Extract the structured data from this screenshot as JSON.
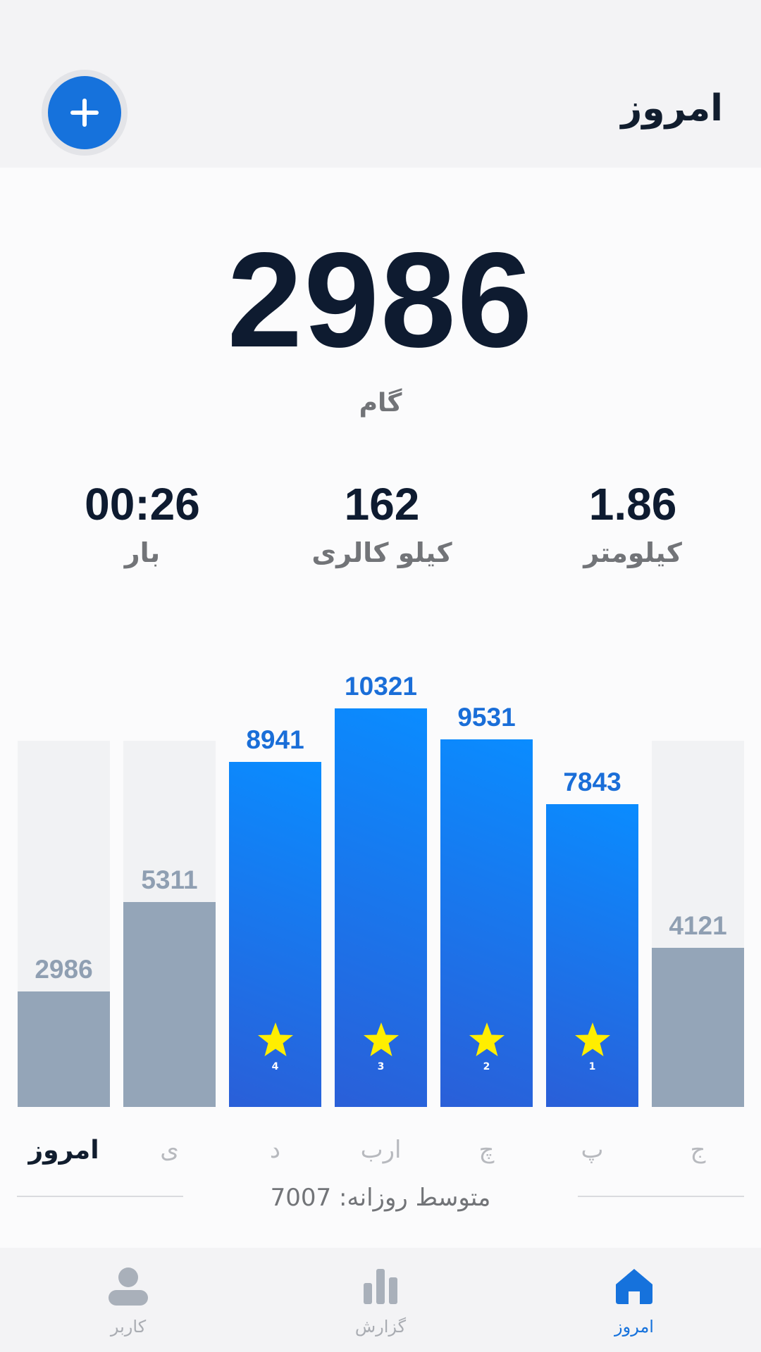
{
  "header": {
    "title": "امروز"
  },
  "summary": {
    "steps": "2986",
    "steps_unit": "گام",
    "stats": [
      {
        "value": "1.86",
        "label": "کیلومتر"
      },
      {
        "value": "162",
        "label": "کیلو کالری"
      },
      {
        "value": "00:26",
        "label": "بار"
      }
    ]
  },
  "chart_data": {
    "type": "bar",
    "direction": "rtl",
    "categories": [
      "ج",
      "پ",
      "چ",
      "ارب",
      "د",
      "ی",
      "امروز"
    ],
    "values": [
      4121,
      7843,
      9531,
      10321,
      8941,
      5311,
      2986
    ],
    "goal_reached": [
      false,
      true,
      true,
      true,
      true,
      false,
      false
    ],
    "star_ranks": [
      "",
      "1",
      "2",
      "3",
      "4",
      "",
      ""
    ],
    "highlighted_category": "امروز",
    "colors": {
      "goal_reached": "#1a6ed8",
      "below_goal": "#94a5b8",
      "star": "#ffee00"
    }
  },
  "average": {
    "label": "متوسط روزانه:",
    "value": "7007"
  },
  "bottom_nav": {
    "items": [
      {
        "label": "امروز",
        "icon": "home-icon",
        "active": true
      },
      {
        "label": "گزارش",
        "icon": "bar-chart-icon",
        "active": false
      },
      {
        "label": "کاربر",
        "icon": "user-icon",
        "active": false
      }
    ]
  },
  "colors": {
    "accent": "#1672dc",
    "text_dark": "#0e1b30",
    "text_muted": "#727478"
  }
}
